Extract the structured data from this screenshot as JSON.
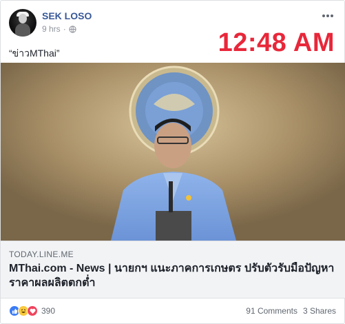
{
  "post": {
    "author": "SEK LOSO",
    "time": "9 hrs",
    "separator": "·",
    "overlay_time": "12:48 AM",
    "caption": "“ข่าวMThai”"
  },
  "link_preview": {
    "domain": "TODAY.LINE.ME",
    "title": "MThai.com - News | นายกฯ แนะภาคการเกษตร ปรับตัวรับมือปัญหาราคาผลผลิตตกต่ำ"
  },
  "engagement": {
    "reaction_count": "390",
    "reactions": [
      "like-icon",
      "haha-icon",
      "love-icon"
    ],
    "comments": "91 Comments",
    "shares": "3 Shares"
  },
  "colors": {
    "author_link": "#385898",
    "overlay_clock": "#e8273a",
    "link_box_bg": "#f2f3f5"
  }
}
